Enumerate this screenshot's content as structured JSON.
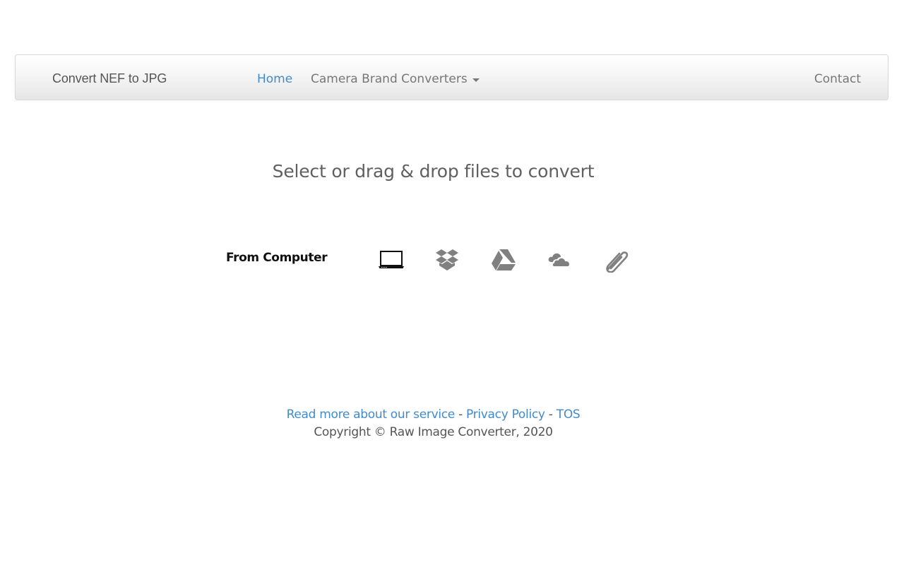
{
  "navbar": {
    "brand": "Convert NEF to JPG",
    "items": [
      {
        "label": "Home",
        "active": true
      },
      {
        "label": "Camera Brand Converters",
        "dropdown": true
      },
      {
        "label": "Contact"
      }
    ]
  },
  "main": {
    "headline": "Select or drag & drop files to convert",
    "source_label": "From Computer",
    "sources": [
      {
        "name": "computer",
        "icon": "laptop-icon"
      },
      {
        "name": "dropbox",
        "icon": "dropbox-icon"
      },
      {
        "name": "google-drive",
        "icon": "google-drive-icon"
      },
      {
        "name": "onedrive",
        "icon": "cloud-icon"
      },
      {
        "name": "url",
        "icon": "paperclip-icon"
      }
    ]
  },
  "footer": {
    "links": [
      {
        "label": "Read more about our service"
      },
      {
        "label": "Privacy Policy"
      },
      {
        "label": "TOS"
      }
    ],
    "separator": " - ",
    "copyright": "Copyright © Raw Image Converter, 2020"
  },
  "colors": {
    "link": "#428bca",
    "text": "#555555",
    "icon_active": "#111111",
    "icon_inactive": "#808080"
  }
}
